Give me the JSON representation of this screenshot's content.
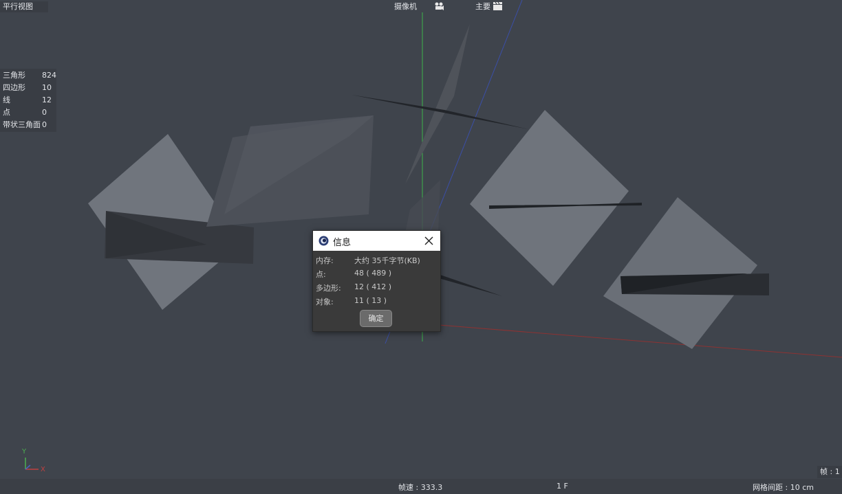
{
  "viewport": {
    "view_name": "平行视图",
    "camera_label": "摄像机",
    "camera_icon": "camera-icon",
    "main_label": "主要",
    "clapper_icon": "clapperboard-icon"
  },
  "stats": [
    {
      "label": "三角形",
      "value": "824"
    },
    {
      "label": "四边形",
      "value": "10"
    },
    {
      "label": "线",
      "value": "12"
    },
    {
      "label": "点",
      "value": "0"
    },
    {
      "label": "带状三角面",
      "value": "0"
    }
  ],
  "axis_gizmo": {
    "y": "Y",
    "x": "X"
  },
  "dialog": {
    "title": "信息",
    "rows": [
      {
        "label": "内存:",
        "value": "大约 35千字节(KB)"
      },
      {
        "label": "点:",
        "value": "48 ( 489 )"
      },
      {
        "label": "多边形:",
        "value": "12 ( 412 )"
      },
      {
        "label": "对象:",
        "value": "11 ( 13 )"
      }
    ],
    "ok_label": "确定"
  },
  "status_bar": {
    "fps": "帧速 : 333.3",
    "frame": "1 F",
    "grid": "网格间距 : 10 cm",
    "frame_badge": "帧 : 1"
  },
  "colors": {
    "background": "#3f444c",
    "axis_green": "#3cb44a",
    "axis_blue": "#3b4fa8",
    "axis_red": "#9e3333",
    "dialog_bg": "#3a3a3a",
    "plane_light": "#6f747c"
  }
}
